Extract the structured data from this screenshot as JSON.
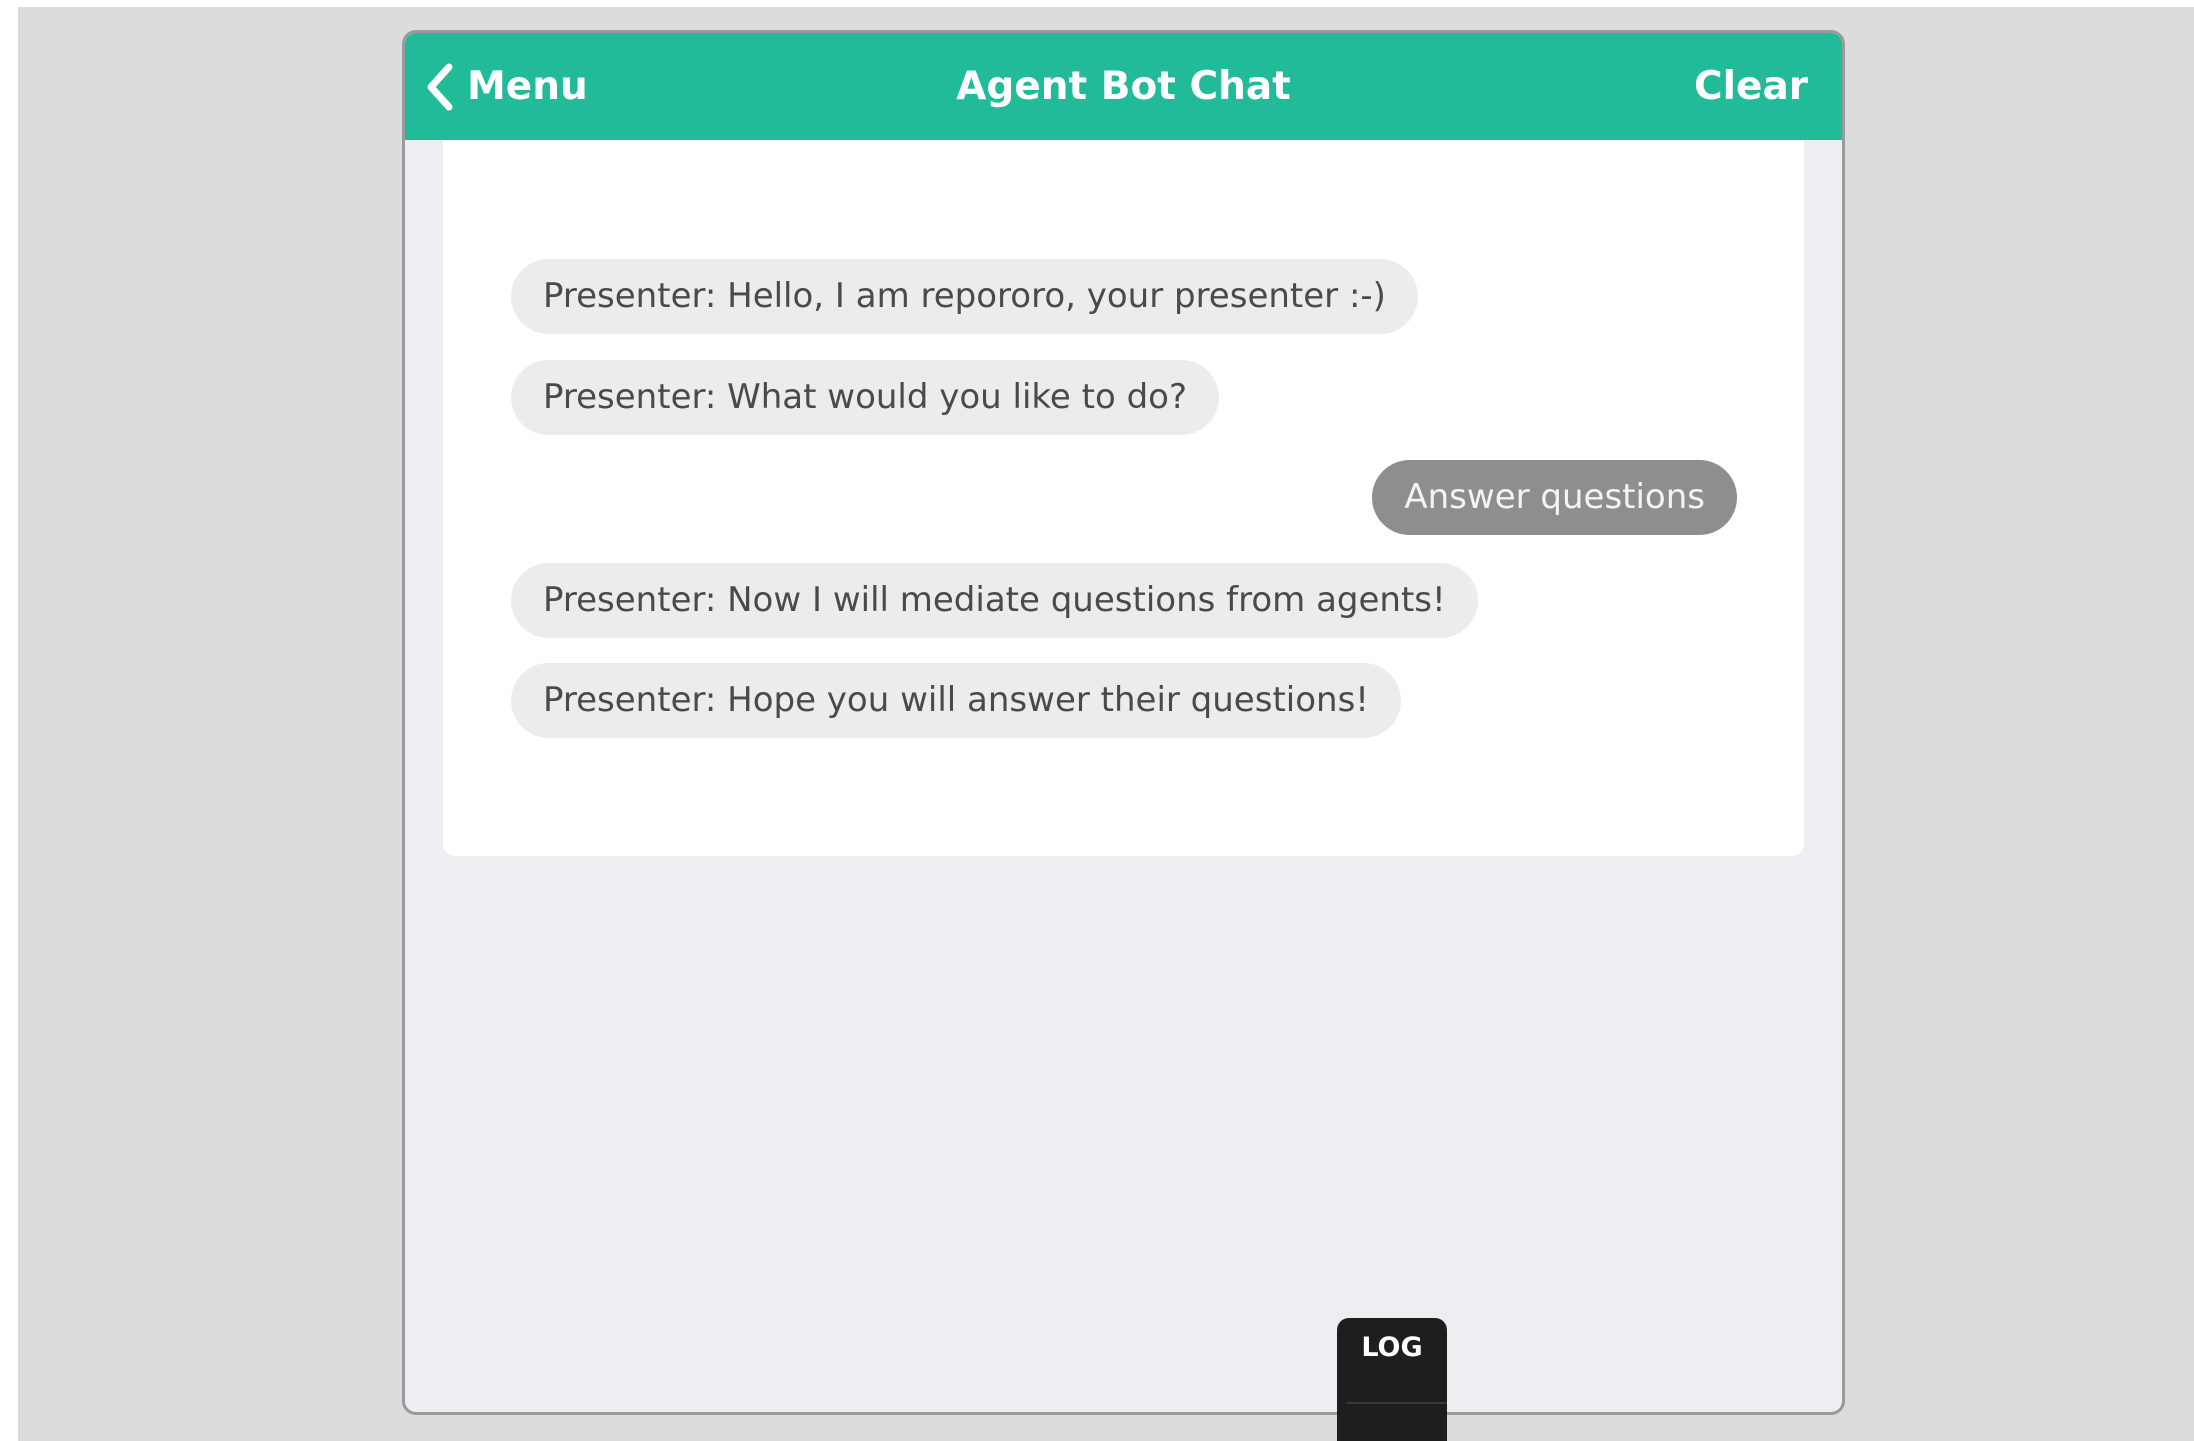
{
  "app": {
    "title": "Agent Bot Chat"
  },
  "navbar": {
    "back_label": "Menu",
    "title": "Agent Bot Chat",
    "clear_label": "Clear"
  },
  "messages": [
    {
      "sender": "bot",
      "text": "Presenter: Hello, I am repororo, your presenter :-)"
    },
    {
      "sender": "bot",
      "text": "Presenter: What would you like to do?"
    },
    {
      "sender": "user",
      "text": "Answer questions"
    },
    {
      "sender": "bot",
      "text": "Presenter: Now I will mediate questions from agents!"
    },
    {
      "sender": "bot",
      "text": "Presenter: Hope you will answer their questions!"
    }
  ],
  "log_tab": {
    "label": "LOG"
  },
  "colors": {
    "accent": "#22bb99",
    "bot_bubble": "#ececec",
    "user_bubble": "#8e8e8e",
    "backdrop": "#dcdcdc",
    "panel": "#eeeef2"
  },
  "icons": {
    "back": "chevron-left-icon"
  }
}
